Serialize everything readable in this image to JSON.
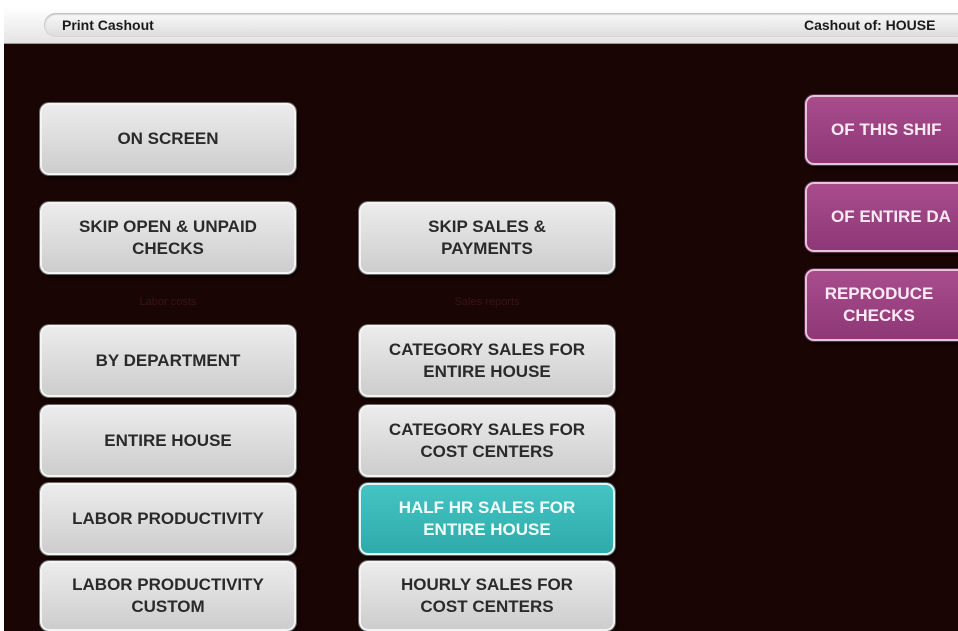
{
  "window": {
    "title": "Print Cashout",
    "cashout_of": "Cashout of: HOUSE"
  },
  "left_column": {
    "on_screen": "ON SCREEN",
    "skip_open_unpaid": "SKIP OPEN & UNPAID\nCHECKS",
    "section_label": "Labor costs",
    "by_department": "BY DEPARTMENT",
    "entire_house": "ENTIRE HOUSE",
    "labor_productivity": "LABOR PRODUCTIVITY",
    "labor_productivity_custom": "LABOR PRODUCTIVITY\nCUSTOM"
  },
  "middle_column": {
    "skip_sales_payments": "SKIP SALES &\nPAYMENTS",
    "section_label": "Sales reports",
    "category_sales_entire_house": "CATEGORY SALES FOR\nENTIRE HOUSE",
    "category_sales_cost_centers": "CATEGORY SALES FOR\nCOST CENTERS",
    "half_hr_sales_entire_house": "HALF HR SALES FOR\nENTIRE HOUSE",
    "hourly_sales_cost_centers": "HOURLY SALES FOR\nCOST CENTERS"
  },
  "right_column": {
    "of_this_shift": "OF THIS SHIF",
    "of_entire_day": "OF ENTIRE DA",
    "reproduce_checks": "REPRODUCE\nCHECKS"
  },
  "colors": {
    "background": "#1a0505",
    "button_grey": "#dcdcdc",
    "button_selected": "#3bb8b8",
    "button_magenta": "#9c4282"
  }
}
